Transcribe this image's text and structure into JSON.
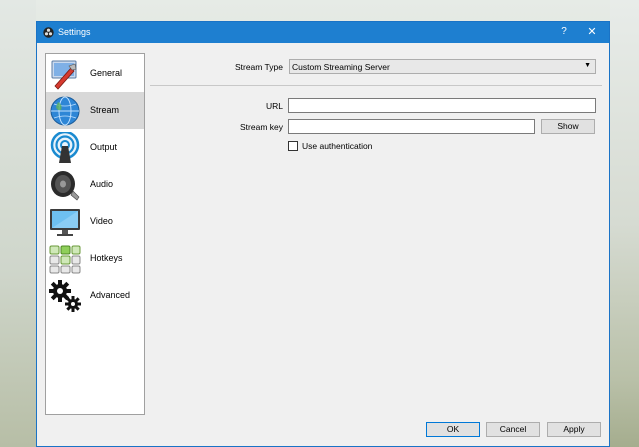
{
  "window": {
    "title": "Settings",
    "help": "?",
    "close": "✕"
  },
  "sidebar": {
    "items": [
      {
        "label": "General",
        "icon": "general-icon",
        "selected": false
      },
      {
        "label": "Stream",
        "icon": "stream-globe-icon",
        "selected": true
      },
      {
        "label": "Output",
        "icon": "output-broadcast-icon",
        "selected": false
      },
      {
        "label": "Audio",
        "icon": "audio-speaker-icon",
        "selected": false
      },
      {
        "label": "Video",
        "icon": "video-monitor-icon",
        "selected": false
      },
      {
        "label": "Hotkeys",
        "icon": "hotkeys-keyboard-icon",
        "selected": false
      },
      {
        "label": "Advanced",
        "icon": "advanced-gears-icon",
        "selected": false
      }
    ]
  },
  "stream": {
    "type_label": "Stream Type",
    "type_value": "Custom Streaming Server",
    "url_label": "URL",
    "url_value": "",
    "key_label": "Stream key",
    "key_value": "",
    "show_label": "Show",
    "auth_label": "Use authentication",
    "auth_checked": false
  },
  "footer": {
    "ok": "OK",
    "cancel": "Cancel",
    "apply": "Apply"
  },
  "colors": {
    "titlebar": "#1e7fd0",
    "selected_item": "#d8d8d8",
    "default_button_border": "#0078d7"
  }
}
